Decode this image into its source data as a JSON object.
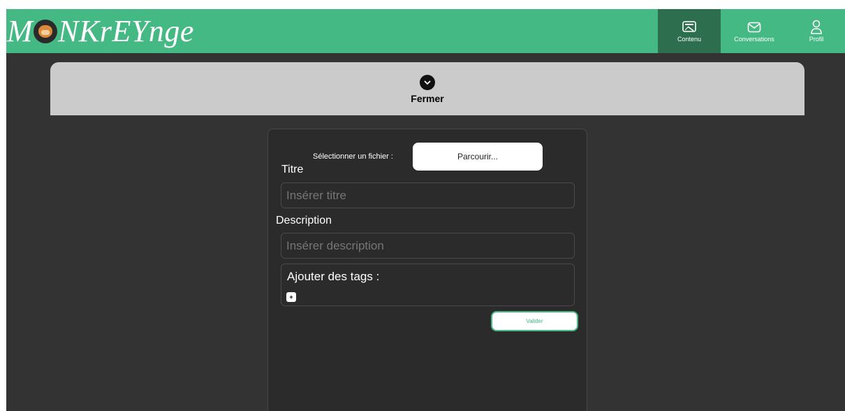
{
  "header": {
    "logo_text_start": "M",
    "logo_text_end": "NKrEYnge",
    "nav": [
      {
        "label": "Contenu",
        "icon": "content-icon",
        "active": true
      },
      {
        "label": "Conversations",
        "icon": "mail-icon",
        "active": false
      },
      {
        "label": "Profil",
        "icon": "profile-icon",
        "active": false
      }
    ]
  },
  "close_panel": {
    "label": "Fermer",
    "icon": "chevron-down-icon"
  },
  "form": {
    "file_label": "Sélectionner un fichier :",
    "file_button": "Parcourir...",
    "title_label": "Titre",
    "title_placeholder": "Insérer titre",
    "description_label": "Description",
    "description_placeholder": "Insérer description",
    "tags_label": "Ajouter des tags :",
    "tags_add": "+",
    "submit_label": "Valider"
  },
  "colors": {
    "brand": "#44b984",
    "nav_active": "#2c6e4e",
    "background": "#333333",
    "panel": "#cbcbcb",
    "card": "#2b2b2b"
  }
}
